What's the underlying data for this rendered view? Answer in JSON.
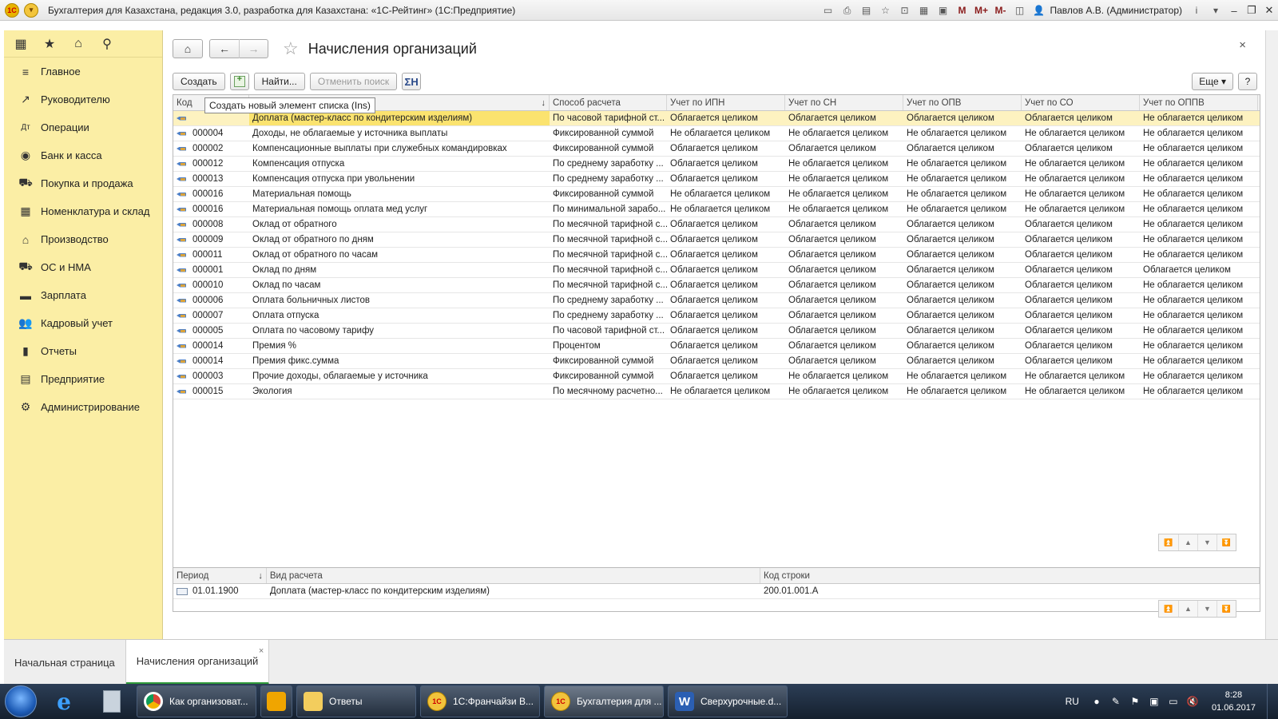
{
  "titlebar": {
    "title": "Бухгалтерия для Казахстана, редакция 3.0, разработка для Казахстана: «1С-Рейтинг» (1С:Предприятие)",
    "logo_text": "1С",
    "m_label": "M",
    "m_plus_label": "M+",
    "m_minus_label": "M-",
    "user": "Павлов А.В. (Администратор)",
    "info_label": "i"
  },
  "sidebar": {
    "items": [
      {
        "label": "Главное",
        "icon": "menu-icon"
      },
      {
        "label": "Руководителю",
        "icon": "chart-line-icon"
      },
      {
        "label": "Операции",
        "icon": "ledger-icon"
      },
      {
        "label": "Банк и касса",
        "icon": "coin-icon"
      },
      {
        "label": "Покупка и продажа",
        "icon": "cart-icon"
      },
      {
        "label": "Номенклатура и склад",
        "icon": "grid-icon"
      },
      {
        "label": "Производство",
        "icon": "factory-icon"
      },
      {
        "label": "ОС и НМА",
        "icon": "truck-icon"
      },
      {
        "label": "Зарплата",
        "icon": "cash-icon"
      },
      {
        "label": "Кадровый учет",
        "icon": "people-icon"
      },
      {
        "label": "Отчеты",
        "icon": "bar-chart-icon"
      },
      {
        "label": "Предприятие",
        "icon": "building-icon"
      },
      {
        "label": "Администрирование",
        "icon": "gear-icon"
      }
    ]
  },
  "form": {
    "title": "Начисления организаций",
    "close": "×"
  },
  "toolbar": {
    "create": "Создать",
    "find": "Найти...",
    "cancel_search": "Отменить поиск",
    "sum_label": "ΣН",
    "more": "Еще ▾",
    "help": "?"
  },
  "tooltip": "Создать новый элемент списка (Ins)",
  "grid": {
    "columns": {
      "code": "Код",
      "name": "",
      "sort": "↓",
      "method": "Способ расчета",
      "ipn": "Учет по ИПН",
      "sn": "Учет по  СН",
      "opv": "Учет по  ОПВ",
      "so": "Учет по  СО",
      "oppv": "Учет по  ОППВ"
    },
    "rows": [
      {
        "code": "",
        "name": "Доплата (мастер-класс по кондитерским изделиям)",
        "method": "По часовой тарифной ст...",
        "ipn": "Облагается целиком",
        "sn": "Облагается целиком",
        "opv": "Облагается целиком",
        "so": "Облагается целиком",
        "oppv": "Не облагается целиком"
      },
      {
        "code": "000004",
        "name": "Доходы, не облагаемые у источника выплаты",
        "method": "Фиксированной суммой",
        "ipn": "Не облагается целиком",
        "sn": "Не облагается целиком",
        "opv": "Не облагается целиком",
        "so": "Не облагается целиком",
        "oppv": "Не облагается целиком"
      },
      {
        "code": "000002",
        "name": "Компенсационные выплаты при служебных командировках",
        "method": "Фиксированной суммой",
        "ipn": "Облагается целиком",
        "sn": "Облагается целиком",
        "opv": "Облагается целиком",
        "so": "Облагается целиком",
        "oppv": "Не облагается целиком"
      },
      {
        "code": "000012",
        "name": "Компенсация отпуска",
        "method": "По среднему заработку ...",
        "ipn": "Облагается целиком",
        "sn": "Не облагается целиком",
        "opv": "Не облагается целиком",
        "so": "Не облагается целиком",
        "oppv": "Не облагается целиком"
      },
      {
        "code": "000013",
        "name": "Компенсация отпуска при увольнении",
        "method": "По среднему заработку ...",
        "ipn": "Облагается целиком",
        "sn": "Не облагается целиком",
        "opv": "Не облагается целиком",
        "so": "Не облагается целиком",
        "oppv": "Не облагается целиком"
      },
      {
        "code": "000016",
        "name": "Материальная помощь",
        "method": "Фиксированной суммой",
        "ipn": "Не облагается целиком",
        "sn": "Не облагается целиком",
        "opv": "Не облагается целиком",
        "so": "Не облагается целиком",
        "oppv": "Не облагается целиком"
      },
      {
        "code": "000016",
        "name": "Материальная помощь оплата мед услуг",
        "method": "По минимальной зарабо...",
        "ipn": "Не облагается целиком",
        "sn": "Не облагается целиком",
        "opv": "Не облагается целиком",
        "so": "Не облагается целиком",
        "oppv": "Не облагается целиком"
      },
      {
        "code": "000008",
        "name": "Оклад от обратного",
        "method": "По месячной тарифной с...",
        "ipn": "Облагается целиком",
        "sn": "Облагается целиком",
        "opv": "Облагается целиком",
        "so": "Облагается целиком",
        "oppv": "Не облагается целиком"
      },
      {
        "code": "000009",
        "name": "Оклад от обратного по дням",
        "method": "По месячной тарифной с...",
        "ipn": "Облагается целиком",
        "sn": "Облагается целиком",
        "opv": "Облагается целиком",
        "so": "Облагается целиком",
        "oppv": "Не облагается целиком"
      },
      {
        "code": "000011",
        "name": "Оклад от обратного по часам",
        "method": "По месячной тарифной с...",
        "ipn": "Облагается целиком",
        "sn": "Облагается целиком",
        "opv": "Облагается целиком",
        "so": "Облагается целиком",
        "oppv": "Не облагается целиком"
      },
      {
        "code": "000001",
        "name": "Оклад по дням",
        "method": "По месячной тарифной с...",
        "ipn": "Облагается целиком",
        "sn": "Облагается целиком",
        "opv": "Облагается целиком",
        "so": "Облагается целиком",
        "oppv": "Облагается целиком"
      },
      {
        "code": "000010",
        "name": "Оклад по часам",
        "method": "По месячной тарифной с...",
        "ipn": "Облагается целиком",
        "sn": "Облагается целиком",
        "opv": "Облагается целиком",
        "so": "Облагается целиком",
        "oppv": "Не облагается целиком"
      },
      {
        "code": "000006",
        "name": "Оплата больничных листов",
        "method": "По среднему заработку ...",
        "ipn": "Облагается целиком",
        "sn": "Облагается целиком",
        "opv": "Облагается целиком",
        "so": "Облагается целиком",
        "oppv": "Не облагается целиком"
      },
      {
        "code": "000007",
        "name": "Оплата отпуска",
        "method": "По среднему заработку ...",
        "ipn": "Облагается целиком",
        "sn": "Облагается целиком",
        "opv": "Облагается целиком",
        "so": "Облагается целиком",
        "oppv": "Не облагается целиком"
      },
      {
        "code": "000005",
        "name": "Оплата по часовому тарифу",
        "method": "По часовой тарифной ст...",
        "ipn": "Облагается целиком",
        "sn": "Облагается целиком",
        "opv": "Облагается целиком",
        "so": "Облагается целиком",
        "oppv": "Не облагается целиком"
      },
      {
        "code": "000014",
        "name": "Премия %",
        "method": "Процентом",
        "ipn": "Облагается целиком",
        "sn": "Облагается целиком",
        "opv": "Облагается целиком",
        "so": "Облагается целиком",
        "oppv": "Не облагается целиком"
      },
      {
        "code": "000014",
        "name": "Премия фикс.сумма",
        "method": "Фиксированной суммой",
        "ipn": "Облагается целиком",
        "sn": "Облагается целиком",
        "opv": "Облагается целиком",
        "so": "Облагается целиком",
        "oppv": "Не облагается целиком"
      },
      {
        "code": "000003",
        "name": "Прочие доходы, облагаемые у источника",
        "method": "Фиксированной суммой",
        "ipn": "Облагается целиком",
        "sn": "Не облагается целиком",
        "opv": "Не облагается целиком",
        "so": "Не облагается целиком",
        "oppv": "Не облагается целиком"
      },
      {
        "code": "000015",
        "name": "Экология",
        "method": "По месячному расчетно...",
        "ipn": "Не облагается целиком",
        "sn": "Не облагается целиком",
        "opv": "Не облагается целиком",
        "so": "Не облагается целиком",
        "oppv": "Не облагается целиком"
      }
    ]
  },
  "subgrid": {
    "columns": {
      "period": "Период",
      "sort": "↓",
      "kind": "Вид расчета",
      "code": "Код строки"
    },
    "rows": [
      {
        "period": "01.01.1900",
        "kind": "Доплата (мастер-класс по кондитерским изделиям)",
        "code": "200.01.001.A"
      }
    ]
  },
  "tabs": [
    {
      "label": "Начальная страница"
    },
    {
      "label": "Начисления организаций",
      "close": "×"
    }
  ],
  "taskbar": {
    "tasks": [
      {
        "label": "Как организоват...",
        "icon": "chrome-icon"
      },
      {
        "label": "",
        "icon": "outlook-icon"
      },
      {
        "label": "Ответы",
        "icon": "folder-icon"
      },
      {
        "label": "1С:Франчайзи В...",
        "icon": "onec-icon"
      },
      {
        "label": "Бухгалтерия для ...",
        "icon": "onec-icon"
      },
      {
        "label": "Сверхурочные.d...",
        "icon": "word-icon"
      }
    ],
    "lang": "RU",
    "time": "8:28",
    "date": "01.06.2017"
  },
  "colors": {
    "sidebar_bg": "#fbeea5",
    "selected_row": "#fbe36f",
    "active_tab_underline": "#2f9a3a"
  }
}
